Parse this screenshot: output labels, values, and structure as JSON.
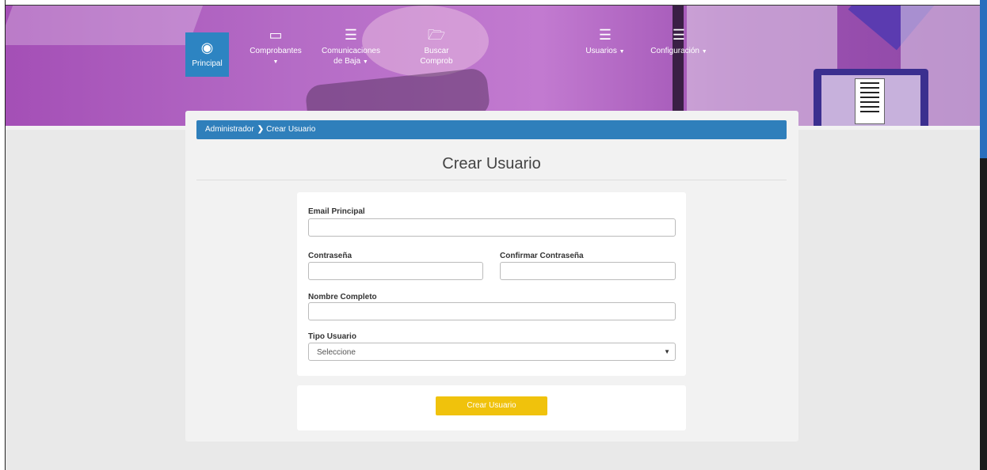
{
  "nav": {
    "items": [
      {
        "label": "Principal",
        "icon": "dashboard-icon",
        "active": true
      },
      {
        "label": "Comprobantes",
        "icon": "laptop-icon"
      },
      {
        "label_line1": "Comunicaciones",
        "label_line2": "de Baja",
        "icon": "list-icon"
      },
      {
        "label_line1": "Buscar",
        "label_line2": "Comprob",
        "icon": "folder-open-icon"
      },
      {
        "label": "Usuarios",
        "icon": "list-icon"
      },
      {
        "label": "Configuración",
        "icon": "list-icon"
      }
    ]
  },
  "breadcrumb": {
    "root": "Administrador",
    "current": "Crear Usuario"
  },
  "page": {
    "title": "Crear Usuario"
  },
  "form": {
    "email_label": "Email Principal",
    "email_value": "",
    "password_label": "Contraseña",
    "password_value": "",
    "confirm_label": "Confirmar Contraseña",
    "confirm_value": "",
    "name_label": "Nombre Completo",
    "name_value": "",
    "type_label": "Tipo Usuario",
    "type_selected": "Seleccione"
  },
  "actions": {
    "create_label": "Crear Usuario"
  },
  "colors": {
    "accent_blue": "#2f7fbb",
    "button_yellow": "#f0c20c",
    "header_purple": "#b56cc6"
  }
}
